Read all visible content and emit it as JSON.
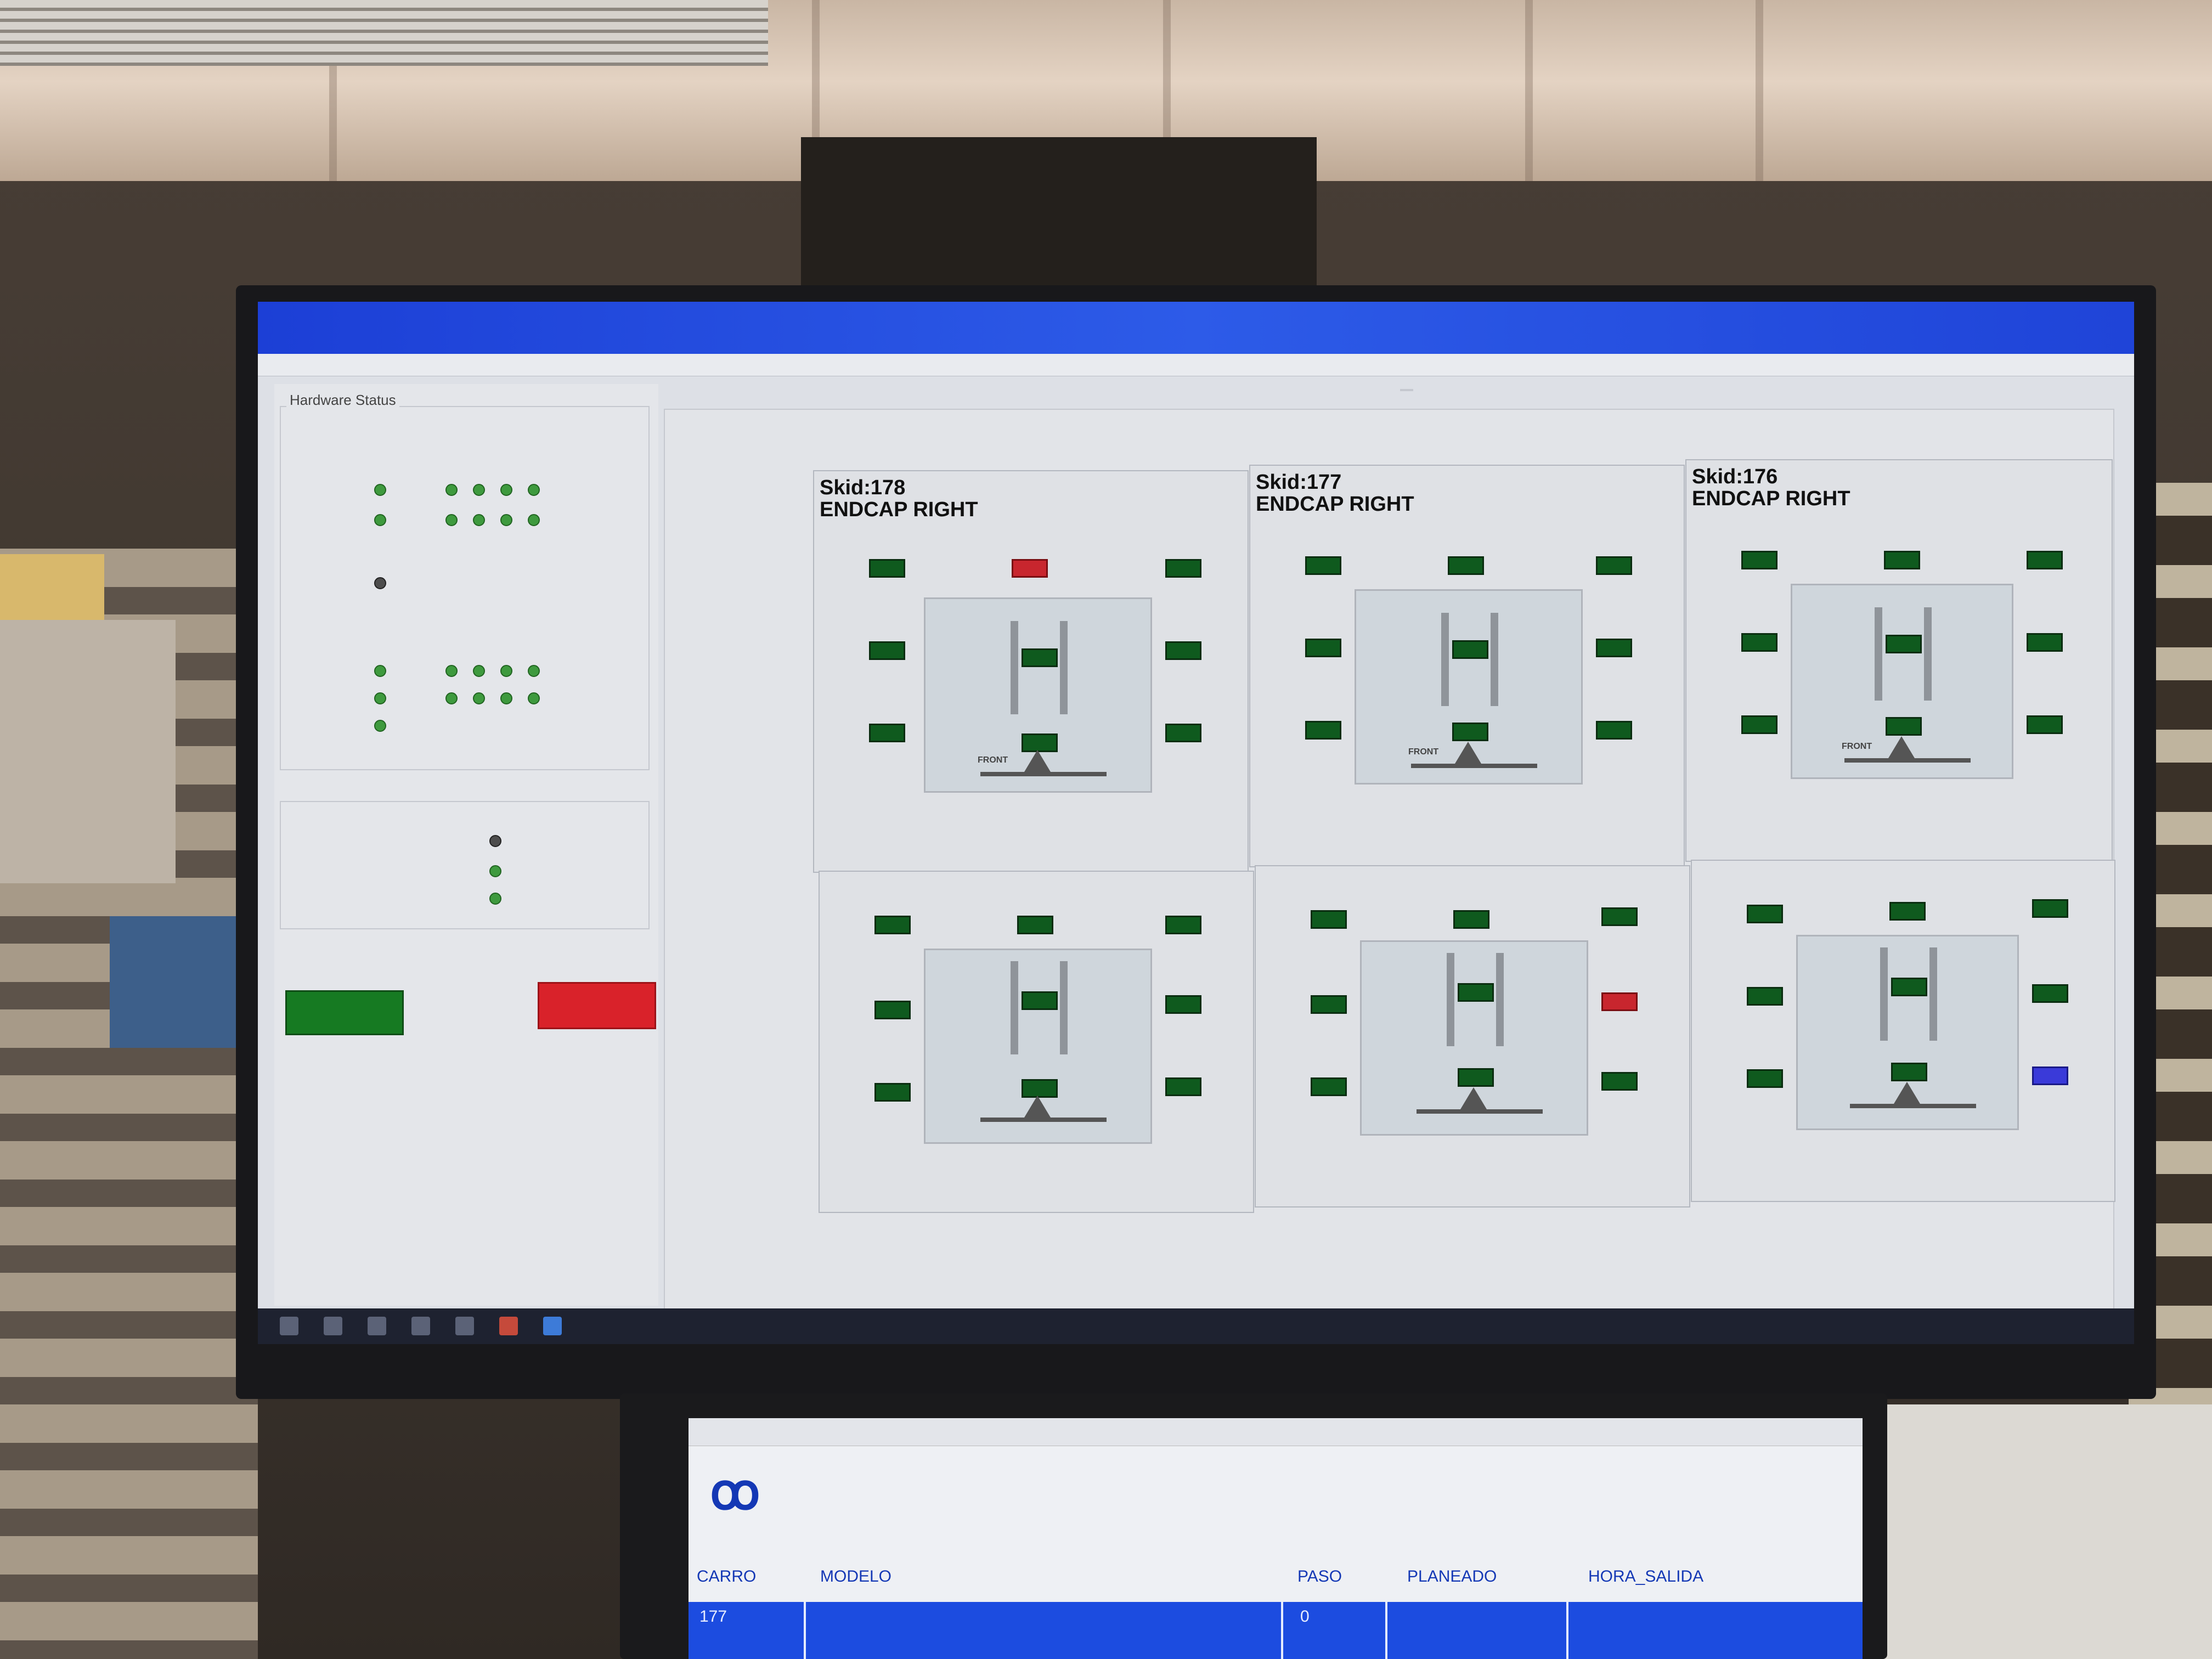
{
  "main_screen": {
    "window_title": "",
    "menu_item": "",
    "tab_label": "",
    "right_tab_left": "",
    "right_tab_right": "",
    "left_panel": {
      "hardware_status_title": "Hardware Status",
      "group1_label": "",
      "group2_label": "",
      "connection_group_title": "",
      "start_button": "",
      "stop_button": ""
    },
    "skids": [
      {
        "title_line1": "Skid:178",
        "title_line2": "ENDCAP RIGHT"
      },
      {
        "title_line1": "Skid:177",
        "title_line2": "ENDCAP RIGHT"
      },
      {
        "title_line1": "Skid:176",
        "title_line2": "ENDCAP RIGHT"
      }
    ],
    "fixture_labels": {
      "top": "FRONT",
      "bottom": ""
    },
    "watermark": "",
    "colors": {
      "ok": "#0f5a1e",
      "alarm": "#c8262e",
      "info": "#3a3ad9",
      "titlebar": "#1f44d8"
    }
  },
  "second_screen": {
    "header": "",
    "header_right": "",
    "columns": {
      "carro": "CARRO",
      "modelo": "MODELO",
      "paso": "PASO",
      "planeado": "PLANEADO",
      "hora_salida": "HORA_SALIDA"
    },
    "row": {
      "carro": "177",
      "modelo": "",
      "paso": "0",
      "planeado": "",
      "hora_salida": ""
    }
  }
}
